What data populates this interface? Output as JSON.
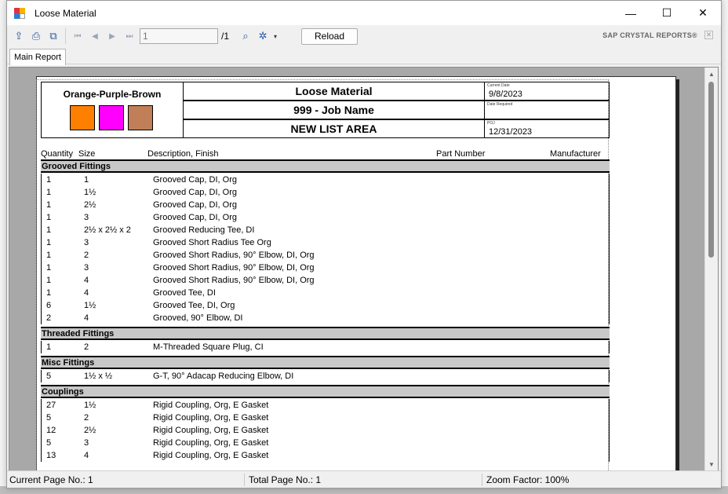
{
  "window": {
    "title": "Loose Material",
    "controls": {
      "minimize": "—",
      "maximize": "☐",
      "close": "✕"
    }
  },
  "toolbar": {
    "page_value": "1",
    "page_total": "/1",
    "reload_label": "Reload",
    "brand": "SAP CRYSTAL REPORTS®"
  },
  "tabs": [
    {
      "label": "Main Report"
    }
  ],
  "report": {
    "combo_name": "Orange-Purple-Brown",
    "swatches": [
      "#ff7f00",
      "#ff00ff",
      "#c07f58"
    ],
    "title": "Loose Material",
    "job": "999 - Job Name",
    "area": "NEW LIST AREA",
    "current_date_label": "Current Date",
    "current_date": "9/8/2023",
    "date_required_label": "Date Required",
    "poj_label": "POJ",
    "poj": "12/31/2023",
    "columns": {
      "quantity": "Quantity",
      "size": "Size",
      "description": "Description, Finish",
      "part": "Part Number",
      "manufacturer": "Manufacturer"
    },
    "sections": [
      {
        "name": "Grooved Fittings",
        "rows": [
          {
            "qty": "1",
            "size": "1",
            "desc": "Grooved Cap, DI, Org"
          },
          {
            "qty": "1",
            "size": "1½",
            "desc": "Grooved Cap, DI, Org"
          },
          {
            "qty": "1",
            "size": "2½",
            "desc": "Grooved Cap, DI, Org"
          },
          {
            "qty": "1",
            "size": "3",
            "desc": "Grooved Cap, DI, Org"
          },
          {
            "qty": "1",
            "size": "2½ x 2½ x 2",
            "desc": "Grooved Reducing Tee, DI"
          },
          {
            "qty": "1",
            "size": "3",
            "desc": "Grooved Short Radius Tee Org"
          },
          {
            "qty": "1",
            "size": "2",
            "desc": "Grooved Short Radius, 90° Elbow, DI, Org"
          },
          {
            "qty": "1",
            "size": "3",
            "desc": "Grooved Short Radius, 90° Elbow, DI, Org"
          },
          {
            "qty": "1",
            "size": "4",
            "desc": "Grooved Short Radius, 90° Elbow, DI, Org"
          },
          {
            "qty": "1",
            "size": "4",
            "desc": "Grooved Tee, DI"
          },
          {
            "qty": "6",
            "size": "1½",
            "desc": "Grooved Tee, DI, Org"
          },
          {
            "qty": "2",
            "size": "4",
            "desc": "Grooved, 90° Elbow, DI"
          }
        ]
      },
      {
        "name": "Threaded Fittings",
        "rows": [
          {
            "qty": "1",
            "size": "2",
            "desc": "M-Threaded Square Plug, CI"
          }
        ]
      },
      {
        "name": "Misc Fittings",
        "rows": [
          {
            "qty": "5",
            "size": "1½ x ½",
            "desc": "G-T, 90° Adacap Reducing Elbow, DI"
          }
        ]
      },
      {
        "name": "Couplings",
        "rows": [
          {
            "qty": "27",
            "size": "1½",
            "desc": "Rigid Coupling, Org, E Gasket"
          },
          {
            "qty": "5",
            "size": "2",
            "desc": "Rigid Coupling, Org, E Gasket"
          },
          {
            "qty": "12",
            "size": "2½",
            "desc": "Rigid Coupling, Org, E Gasket"
          },
          {
            "qty": "5",
            "size": "3",
            "desc": "Rigid Coupling, Org, E Gasket"
          },
          {
            "qty": "13",
            "size": "4",
            "desc": "Rigid Coupling, Org, E Gasket"
          }
        ]
      }
    ]
  },
  "status": {
    "current_page": "Current Page No.: 1",
    "total_page": "Total Page No.: 1",
    "zoom": "Zoom Factor: 100%"
  }
}
